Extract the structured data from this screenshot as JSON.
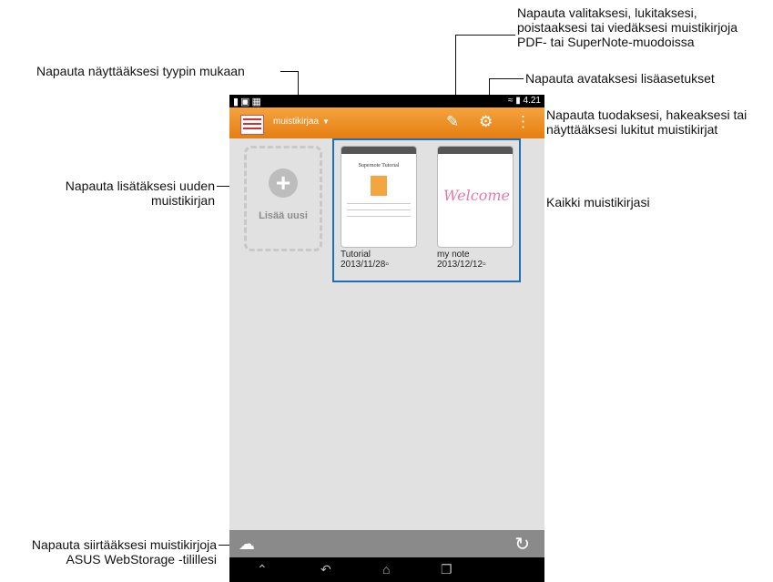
{
  "callouts": {
    "filter_type": "Napauta näyttääksesi tyypin mukaan",
    "select_lock": "Napauta valitaksesi, lukitaksesi,\npoistaaksesi tai viedäksesi muistikirjoja\nPDF- tai SuperNote-muodoissa",
    "settings": "Napauta avataksesi lisäasetukset",
    "import_search": "Napauta tuodaksesi, hakeaksesi tai\nnäyttääksesi lukitut muistikirjat",
    "add_notebook": "Napauta lisätäksesi uuden\nmuistikirjan",
    "all_notebooks": "Kaikki muistikirjasi",
    "webstorage": "Napauta siirtääksesi muistikirjoja\nASUS WebStorage -tilillesi"
  },
  "status_bar": {
    "time": "4.21"
  },
  "action_bar": {
    "dropdown_label": "muistikirjaa"
  },
  "add_new": {
    "label": "Lisää uusi"
  },
  "notebooks": [
    {
      "title": "Tutorial",
      "date": "2013/11/28",
      "cover_text": "Supernote Tutorial"
    },
    {
      "title": "my note",
      "date": "2013/12/12",
      "cover_text": "Welcome"
    }
  ],
  "colors": {
    "action_bar": "#e8871a",
    "selection": "#1c6fb8",
    "background": "#e1e1e1"
  }
}
